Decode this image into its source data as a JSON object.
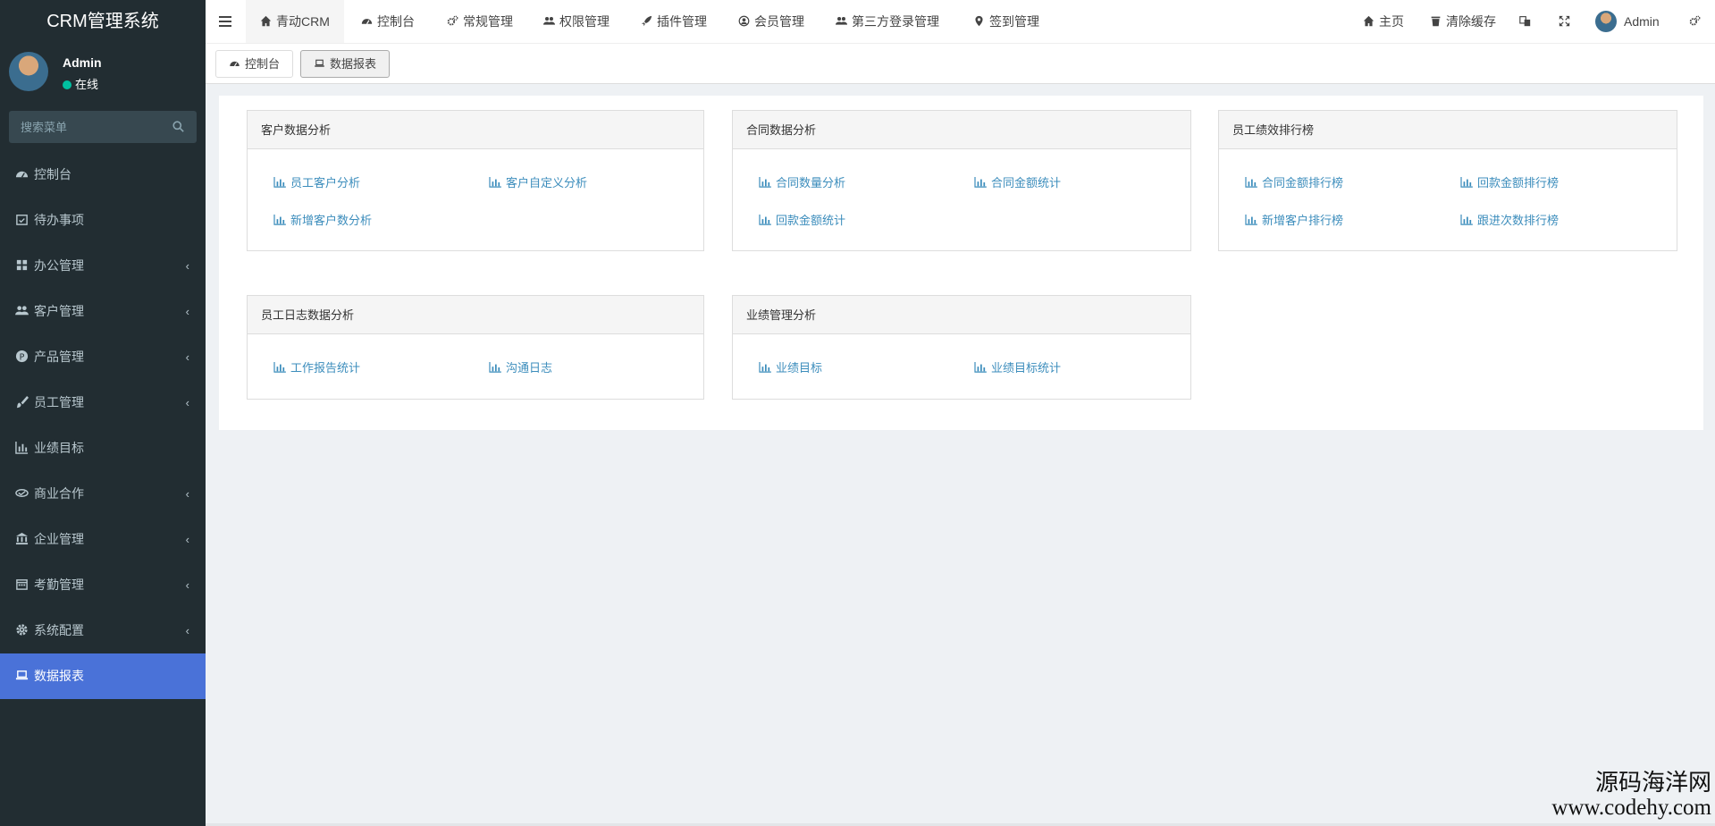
{
  "brand": "CRM管理系统",
  "user": {
    "name": "Admin",
    "status": "在线"
  },
  "search": {
    "placeholder": "搜索菜单"
  },
  "sidebar": {
    "items": [
      {
        "label": "控制台",
        "icon": "dashboard-icon",
        "has_arrow": false
      },
      {
        "label": "待办事项",
        "icon": "calendar-check-icon",
        "has_arrow": false
      },
      {
        "label": "办公管理",
        "icon": "windows-icon",
        "has_arrow": true
      },
      {
        "label": "客户管理",
        "icon": "users-icon",
        "has_arrow": true
      },
      {
        "label": "产品管理",
        "icon": "product-icon",
        "has_arrow": true
      },
      {
        "label": "员工管理",
        "icon": "brush-icon",
        "has_arrow": true
      },
      {
        "label": "业绩目标",
        "icon": "bar-chart-icon",
        "has_arrow": false
      },
      {
        "label": "商业合作",
        "icon": "handshake-icon",
        "has_arrow": true
      },
      {
        "label": "企业管理",
        "icon": "bank-icon",
        "has_arrow": true
      },
      {
        "label": "考勤管理",
        "icon": "calendar-icon",
        "has_arrow": true
      },
      {
        "label": "系统配置",
        "icon": "gear-icon",
        "has_arrow": true
      },
      {
        "label": "数据报表",
        "icon": "laptop-icon",
        "has_arrow": false,
        "active": true
      }
    ],
    "arrow": "‹"
  },
  "header": {
    "nav": [
      {
        "label": "青动CRM",
        "icon": "home-icon",
        "active": true
      },
      {
        "label": "控制台",
        "icon": "dashboard-icon"
      },
      {
        "label": "常规管理",
        "icon": "cogs-icon"
      },
      {
        "label": "权限管理",
        "icon": "users-icon"
      },
      {
        "label": "插件管理",
        "icon": "rocket-icon"
      },
      {
        "label": "会员管理",
        "icon": "user-circle-icon"
      },
      {
        "label": "第三方登录管理",
        "icon": "users-icon"
      },
      {
        "label": "签到管理",
        "icon": "map-marker-icon"
      }
    ],
    "right": {
      "home": "主页",
      "clear_cache": "清除缓存",
      "admin": "Admin"
    }
  },
  "tabs": [
    {
      "label": "控制台",
      "icon": "dashboard-icon"
    },
    {
      "label": "数据报表",
      "icon": "laptop-icon",
      "active": true
    }
  ],
  "panels": [
    {
      "title": "客户数据分析",
      "links": [
        "员工客户分析",
        "客户自定义分析",
        "新增客户数分析"
      ]
    },
    {
      "title": "合同数据分析",
      "links": [
        "合同数量分析",
        "合同金额统计",
        "回款金额统计"
      ]
    },
    {
      "title": "员工绩效排行榜",
      "links": [
        "合同金额排行榜",
        "回款金额排行榜",
        "新增客户排行榜",
        "跟进次数排行榜"
      ]
    },
    {
      "title": "员工日志数据分析",
      "links": [
        "工作报告统计",
        "沟通日志"
      ]
    },
    {
      "title": "业绩管理分析",
      "links": [
        "业绩目标",
        "业绩目标统计"
      ]
    }
  ],
  "watermark": {
    "line1": "源码海洋网",
    "line2": "www.codehy.com"
  },
  "colors": {
    "sidebar_bg": "#222d32",
    "active": "#4a72d8",
    "link": "#3c8dbc"
  }
}
